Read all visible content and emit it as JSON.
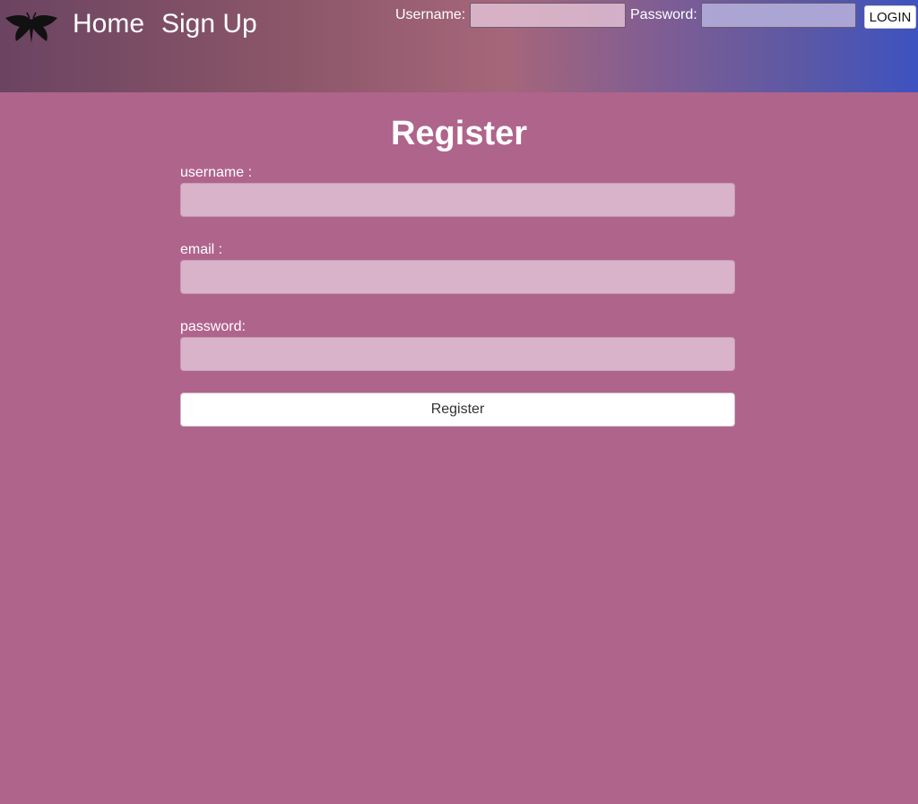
{
  "nav": {
    "logo_icon": "moth-icon",
    "home_label": "Home",
    "signup_label": "Sign Up"
  },
  "login": {
    "username_label": "Username:",
    "password_label": "Password:",
    "username_value": "",
    "password_value": "",
    "button_label": "LOGIN"
  },
  "register_form": {
    "title": "Register",
    "username_label": "username :",
    "email_label": "email :",
    "password_label": "password:",
    "username_value": "",
    "email_value": "",
    "password_value": "",
    "submit_label": "Register"
  },
  "colors": {
    "page_background": "#af648c",
    "header_gradient_start": "#6b4462",
    "header_gradient_end": "#3e52c0",
    "input_background": "#d9b3ca"
  }
}
